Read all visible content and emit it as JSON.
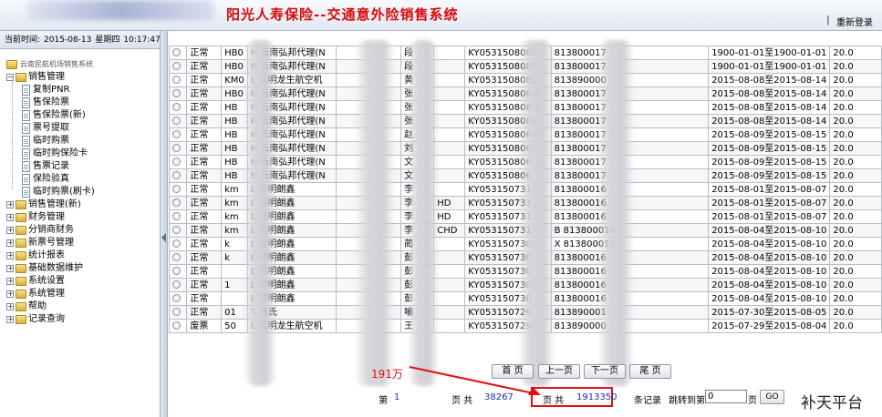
{
  "header": {
    "title": "阳光人寿保险--交通意外险销售系统",
    "separator": "|",
    "relogin": "重新登录"
  },
  "status": {
    "label": "当前时间:",
    "date": "2015-08-13",
    "weekday": "星期四",
    "time": "10:17:47"
  },
  "tree": [
    {
      "label": "云南民航机场销售系统",
      "level": 0,
      "kind": "root"
    },
    {
      "label": "销售管理",
      "level": 1,
      "kind": "folder",
      "expander": "−"
    },
    {
      "label": "复制PNR",
      "level": 2,
      "kind": "doc"
    },
    {
      "label": "售保险票",
      "level": 2,
      "kind": "doc"
    },
    {
      "label": "售保险票(新)",
      "level": 2,
      "kind": "doc"
    },
    {
      "label": "票号提取",
      "level": 2,
      "kind": "doc"
    },
    {
      "label": "临时购票",
      "level": 2,
      "kind": "doc"
    },
    {
      "label": "临时购保险卡",
      "level": 2,
      "kind": "doc"
    },
    {
      "label": "售票记录",
      "level": 2,
      "kind": "doc"
    },
    {
      "label": "保险验真",
      "level": 2,
      "kind": "doc"
    },
    {
      "label": "临时购票(刷卡)",
      "level": 2,
      "kind": "doc"
    },
    {
      "label": "销售管理(新)",
      "level": 1,
      "kind": "folder",
      "expander": "+"
    },
    {
      "label": "财务管理",
      "level": 1,
      "kind": "folder",
      "expander": "+"
    },
    {
      "label": "分销商财务",
      "level": 1,
      "kind": "folder",
      "expander": "+"
    },
    {
      "label": "新票号管理",
      "level": 1,
      "kind": "folder",
      "expander": "+"
    },
    {
      "label": "统计报表",
      "level": 1,
      "kind": "folder",
      "expander": "+"
    },
    {
      "label": "基础数据维护",
      "level": 1,
      "kind": "folder",
      "expander": "+"
    },
    {
      "label": "系统设置",
      "level": 1,
      "kind": "folder",
      "expander": "+"
    },
    {
      "label": "系统管理",
      "level": 1,
      "kind": "folder",
      "expander": "+"
    },
    {
      "label": "帮助",
      "level": 1,
      "kind": "folder",
      "expander": "+"
    },
    {
      "label": "记录查询",
      "level": 1,
      "kind": "folder",
      "expander": "+"
    }
  ],
  "table": {
    "rows": [
      [
        "正常",
        "HB0",
        "H 云南弘邦代理(N",
        "段",
        "",
        "KY053150808E",
        "813800017",
        "",
        "1900-01-01至1900-01-01",
        "20.0"
      ],
      [
        "正常",
        "HB0",
        "H 云南弘邦代理(N",
        "段",
        "",
        "KY053150808A",
        "813800017",
        "",
        "1900-01-01至1900-01-01",
        "20.0"
      ],
      [
        "正常",
        "KM0",
        "L 昆明龙生航空机",
        "黄",
        "",
        "KY053150808D",
        "813890000",
        "",
        "2015-08-08至2015-08-14",
        "20.0"
      ],
      [
        "正常",
        "HB0",
        "H 云南弘邦代理(N",
        "张",
        "",
        "KY053150808 2",
        "813800017",
        "",
        "2015-08-08至2015-08-14",
        "20.0"
      ],
      [
        "正常",
        "HB",
        "H 云南弘邦代理(N",
        "张",
        "",
        "KY053150808 3",
        "813800017",
        "",
        "2015-08-08至2015-08-14",
        "20.0"
      ],
      [
        "正常",
        "HB",
        "H 云南弘邦代理(N",
        "张",
        "",
        "KY053150808X",
        "813800017",
        "",
        "2015-08-08至2015-08-14",
        "20.0"
      ],
      [
        "正常",
        "HB",
        "H 云南弘邦代理(N",
        "赵",
        "",
        "KY053150806 0",
        "813800017",
        "",
        "2015-08-09至2015-08-15",
        "20.0"
      ],
      [
        "正常",
        "HB",
        "H 云南弘邦代理(N",
        "刘",
        "",
        "KY053150806D",
        "813800017",
        "",
        "2015-08-09至2015-08-15",
        "20.0"
      ],
      [
        "正常",
        "HB",
        "H 云南弘邦代理(N",
        "文",
        "",
        "KY053150806 1",
        "813800017",
        "",
        "2015-08-09至2015-08-15",
        "20.0"
      ],
      [
        "正常",
        "HB",
        "H 云南弘邦代理(N",
        "文",
        "",
        "KY053150806",
        "813800017",
        "",
        "2015-08-09至2015-08-15",
        "20.0"
      ],
      [
        "正常",
        "km",
        "L 昆明朗鑫",
        "李",
        "",
        "KY053150731",
        "813800016",
        "",
        "2015-08-01至2015-08-07",
        "20.0"
      ],
      [
        "正常",
        "km",
        "L 昆明朗鑫",
        "李",
        "HD",
        "KY053150731",
        "813800016",
        "",
        "2015-08-01至2015-08-07",
        "20.0"
      ],
      [
        "正常",
        "km",
        "L 昆明朗鑫",
        "李",
        "HD",
        "KY053150731",
        "813800016",
        "",
        "2015-08-01至2015-08-07",
        "20.0"
      ],
      [
        "正常",
        "km",
        "L 昆明朗鑫",
        "李",
        "CHD",
        "KY053150731",
        "B 813800016",
        "",
        "2015-08-04至2015-08-10",
        "20.0"
      ],
      [
        "正常",
        "k",
        "L 昆明朗鑫",
        "蔺",
        "",
        "KY053150730",
        "X 813800016",
        "",
        "2015-08-04至2015-08-10",
        "20.0"
      ],
      [
        "正常",
        "k",
        "L 昆明朗鑫",
        "彭",
        "",
        "KY053150730",
        "813800016",
        "",
        "2015-08-04至2015-08-10",
        "20.0"
      ],
      [
        "正常",
        "",
        "L 昆明朗鑫",
        "彭",
        "",
        "KY053150730",
        "813800016",
        "",
        "2015-08-04至2015-08-10",
        "20.0"
      ],
      [
        "正常",
        "1",
        "L 昆明朗鑫",
        "彭",
        "",
        "KY053150730",
        "813800016",
        "",
        "2015-08-04至2015-08-10",
        "20.0"
      ],
      [
        "正常",
        "",
        "L 昆明朗鑫",
        "彭",
        "",
        "KY053150730",
        "813800016",
        "",
        "2015-08-04至2015-08-10",
        "20.0"
      ],
      [
        "正常",
        "01",
        "T 唐氏",
        "喻",
        "",
        "KY053150729",
        "813890001",
        "",
        "2015-07-30至2015-08-05",
        "20.0"
      ],
      [
        "废票",
        "50",
        "L 昆明龙生航空机",
        "王",
        "",
        "KY053150729",
        "813890000",
        "",
        "2015-07-29至2015-08-04",
        "20.0"
      ]
    ]
  },
  "pager": {
    "first": "首 页",
    "prev": "上一页",
    "next": "下一页",
    "last": "尾 页",
    "page_label": "第",
    "page_number": "1",
    "page_unit": "页 共",
    "total_pages": "38267",
    "total_label": "页 共",
    "total_records": "1913350",
    "records_label": "条记录",
    "jump_label": "跳转到第",
    "jump_value": "0",
    "jump_unit": "页",
    "go": "GO"
  },
  "annotation": {
    "text": "191万",
    "color": "#e01010"
  },
  "watermark": "补天平台",
  "colors": {
    "title_red": "#d50b0b",
    "link_blue": "#1a2fa8",
    "header_bg": "#e3e9f2"
  }
}
